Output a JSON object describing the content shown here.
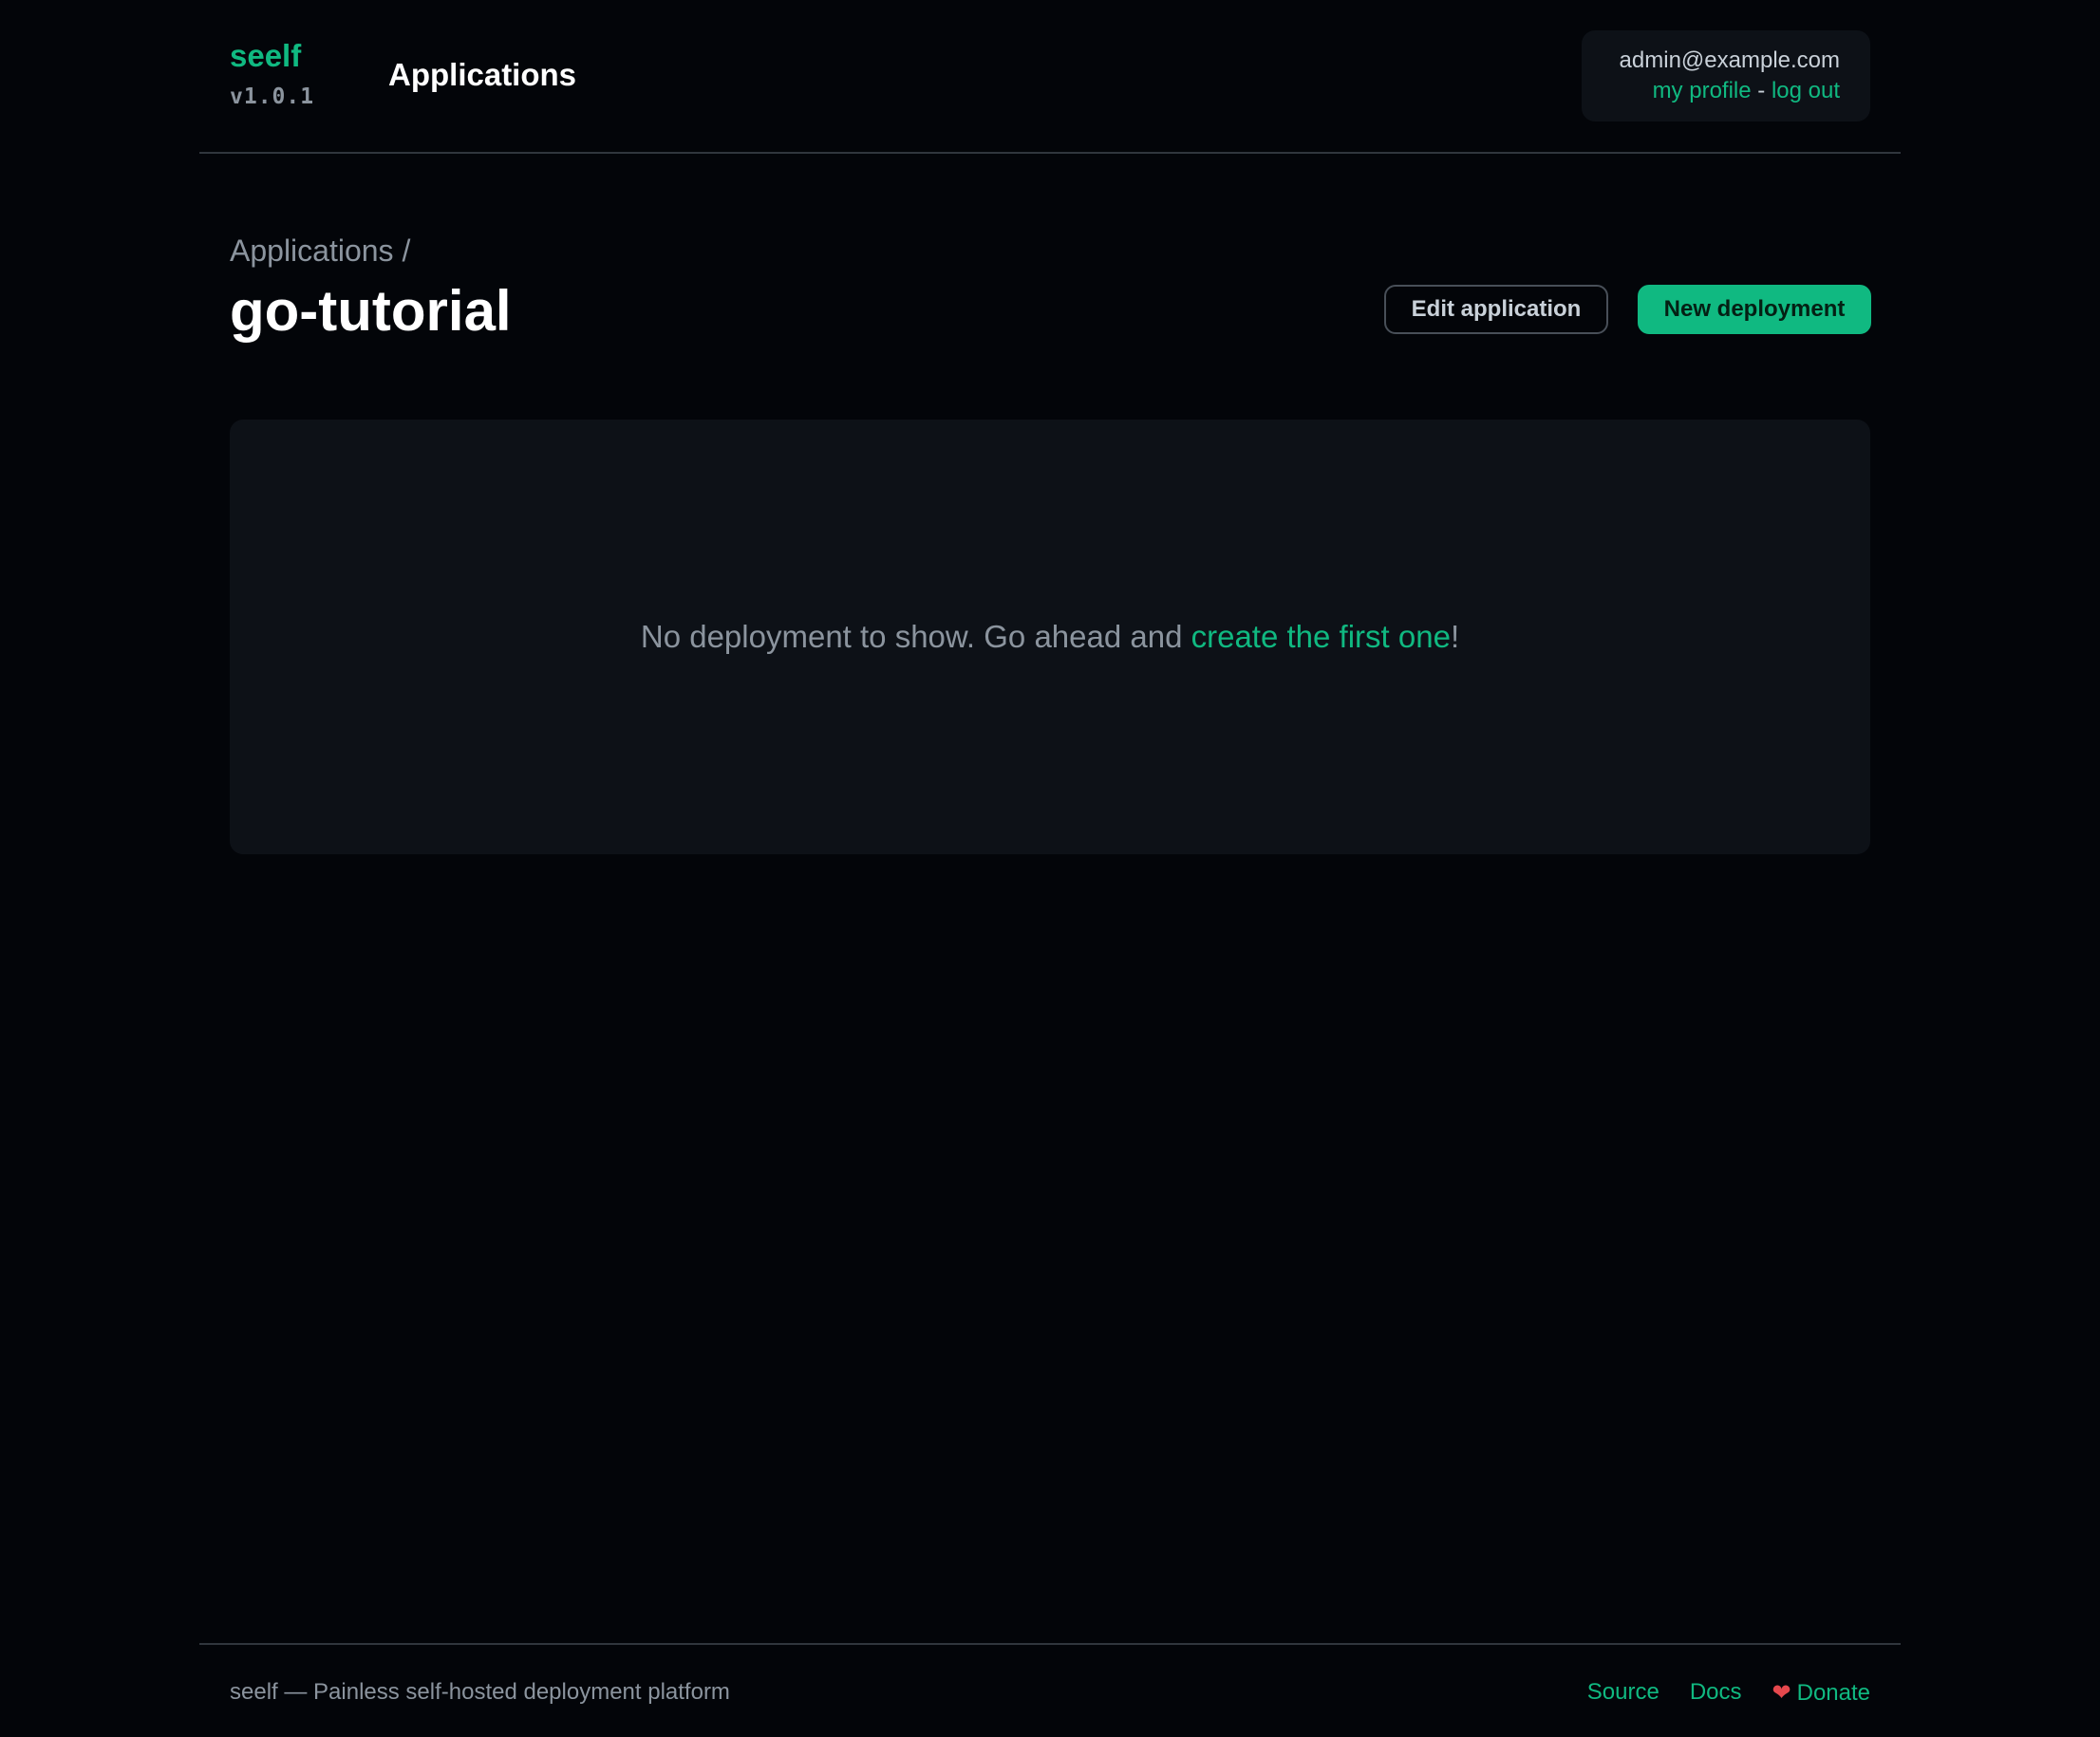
{
  "header": {
    "brand": "seelf",
    "version": "v1.0.1",
    "nav_applications": "Applications",
    "user_email": "admin@example.com",
    "my_profile": "my profile",
    "separator": "-",
    "log_out": "log out"
  },
  "page": {
    "breadcrumb": "Applications /",
    "title": "go-tutorial",
    "edit_button": "Edit application",
    "new_button": "New deployment"
  },
  "empty_state": {
    "text_before": "No deployment to show. Go ahead and ",
    "link": "create the first one",
    "text_after": "!"
  },
  "footer": {
    "tagline": "seelf — Painless self-hosted deployment platform",
    "source": "Source",
    "docs": "Docs",
    "heart": "❤",
    "donate": "Donate"
  },
  "colors": {
    "background": "#030509",
    "accent": "#10b981",
    "panel": "#0d1117"
  }
}
